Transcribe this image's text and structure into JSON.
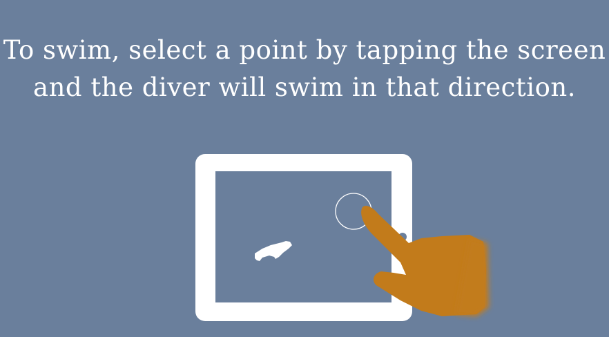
{
  "instruction": {
    "text": "To swim, select a point by tapping the screen and the diver will swim in that direction."
  },
  "illustration": {
    "device": "tablet-icon",
    "figure": "diver-icon",
    "target": "tap-target-circle-icon",
    "hand": "pointing-hand-icon"
  },
  "colors": {
    "background": "#6a7f9c",
    "hand": "#c27b1b",
    "foreground": "#ffffff"
  }
}
